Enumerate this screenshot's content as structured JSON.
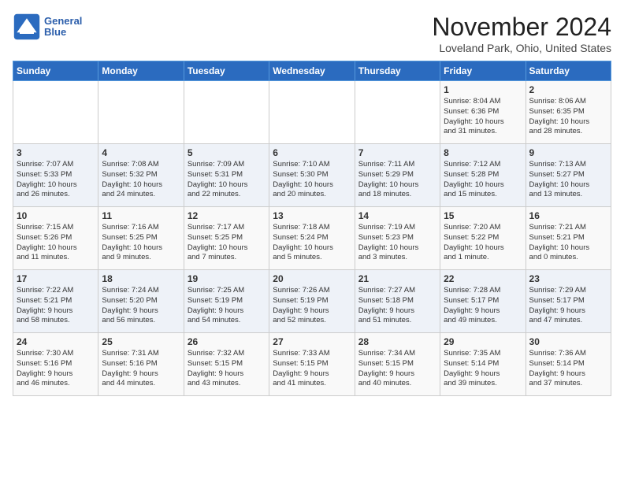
{
  "header": {
    "logo_line1": "General",
    "logo_line2": "Blue",
    "month_title": "November 2024",
    "location": "Loveland Park, Ohio, United States"
  },
  "days_of_week": [
    "Sunday",
    "Monday",
    "Tuesday",
    "Wednesday",
    "Thursday",
    "Friday",
    "Saturday"
  ],
  "weeks": [
    [
      {
        "day": "",
        "data": ""
      },
      {
        "day": "",
        "data": ""
      },
      {
        "day": "",
        "data": ""
      },
      {
        "day": "",
        "data": ""
      },
      {
        "day": "",
        "data": ""
      },
      {
        "day": "1",
        "data": "Sunrise: 8:04 AM\nSunset: 6:36 PM\nDaylight: 10 hours\nand 31 minutes."
      },
      {
        "day": "2",
        "data": "Sunrise: 8:06 AM\nSunset: 6:35 PM\nDaylight: 10 hours\nand 28 minutes."
      }
    ],
    [
      {
        "day": "3",
        "data": "Sunrise: 7:07 AM\nSunset: 5:33 PM\nDaylight: 10 hours\nand 26 minutes."
      },
      {
        "day": "4",
        "data": "Sunrise: 7:08 AM\nSunset: 5:32 PM\nDaylight: 10 hours\nand 24 minutes."
      },
      {
        "day": "5",
        "data": "Sunrise: 7:09 AM\nSunset: 5:31 PM\nDaylight: 10 hours\nand 22 minutes."
      },
      {
        "day": "6",
        "data": "Sunrise: 7:10 AM\nSunset: 5:30 PM\nDaylight: 10 hours\nand 20 minutes."
      },
      {
        "day": "7",
        "data": "Sunrise: 7:11 AM\nSunset: 5:29 PM\nDaylight: 10 hours\nand 18 minutes."
      },
      {
        "day": "8",
        "data": "Sunrise: 7:12 AM\nSunset: 5:28 PM\nDaylight: 10 hours\nand 15 minutes."
      },
      {
        "day": "9",
        "data": "Sunrise: 7:13 AM\nSunset: 5:27 PM\nDaylight: 10 hours\nand 13 minutes."
      }
    ],
    [
      {
        "day": "10",
        "data": "Sunrise: 7:15 AM\nSunset: 5:26 PM\nDaylight: 10 hours\nand 11 minutes."
      },
      {
        "day": "11",
        "data": "Sunrise: 7:16 AM\nSunset: 5:25 PM\nDaylight: 10 hours\nand 9 minutes."
      },
      {
        "day": "12",
        "data": "Sunrise: 7:17 AM\nSunset: 5:25 PM\nDaylight: 10 hours\nand 7 minutes."
      },
      {
        "day": "13",
        "data": "Sunrise: 7:18 AM\nSunset: 5:24 PM\nDaylight: 10 hours\nand 5 minutes."
      },
      {
        "day": "14",
        "data": "Sunrise: 7:19 AM\nSunset: 5:23 PM\nDaylight: 10 hours\nand 3 minutes."
      },
      {
        "day": "15",
        "data": "Sunrise: 7:20 AM\nSunset: 5:22 PM\nDaylight: 10 hours\nand 1 minute."
      },
      {
        "day": "16",
        "data": "Sunrise: 7:21 AM\nSunset: 5:21 PM\nDaylight: 10 hours\nand 0 minutes."
      }
    ],
    [
      {
        "day": "17",
        "data": "Sunrise: 7:22 AM\nSunset: 5:21 PM\nDaylight: 9 hours\nand 58 minutes."
      },
      {
        "day": "18",
        "data": "Sunrise: 7:24 AM\nSunset: 5:20 PM\nDaylight: 9 hours\nand 56 minutes."
      },
      {
        "day": "19",
        "data": "Sunrise: 7:25 AM\nSunset: 5:19 PM\nDaylight: 9 hours\nand 54 minutes."
      },
      {
        "day": "20",
        "data": "Sunrise: 7:26 AM\nSunset: 5:19 PM\nDaylight: 9 hours\nand 52 minutes."
      },
      {
        "day": "21",
        "data": "Sunrise: 7:27 AM\nSunset: 5:18 PM\nDaylight: 9 hours\nand 51 minutes."
      },
      {
        "day": "22",
        "data": "Sunrise: 7:28 AM\nSunset: 5:17 PM\nDaylight: 9 hours\nand 49 minutes."
      },
      {
        "day": "23",
        "data": "Sunrise: 7:29 AM\nSunset: 5:17 PM\nDaylight: 9 hours\nand 47 minutes."
      }
    ],
    [
      {
        "day": "24",
        "data": "Sunrise: 7:30 AM\nSunset: 5:16 PM\nDaylight: 9 hours\nand 46 minutes."
      },
      {
        "day": "25",
        "data": "Sunrise: 7:31 AM\nSunset: 5:16 PM\nDaylight: 9 hours\nand 44 minutes."
      },
      {
        "day": "26",
        "data": "Sunrise: 7:32 AM\nSunset: 5:15 PM\nDaylight: 9 hours\nand 43 minutes."
      },
      {
        "day": "27",
        "data": "Sunrise: 7:33 AM\nSunset: 5:15 PM\nDaylight: 9 hours\nand 41 minutes."
      },
      {
        "day": "28",
        "data": "Sunrise: 7:34 AM\nSunset: 5:15 PM\nDaylight: 9 hours\nand 40 minutes."
      },
      {
        "day": "29",
        "data": "Sunrise: 7:35 AM\nSunset: 5:14 PM\nDaylight: 9 hours\nand 39 minutes."
      },
      {
        "day": "30",
        "data": "Sunrise: 7:36 AM\nSunset: 5:14 PM\nDaylight: 9 hours\nand 37 minutes."
      }
    ]
  ]
}
